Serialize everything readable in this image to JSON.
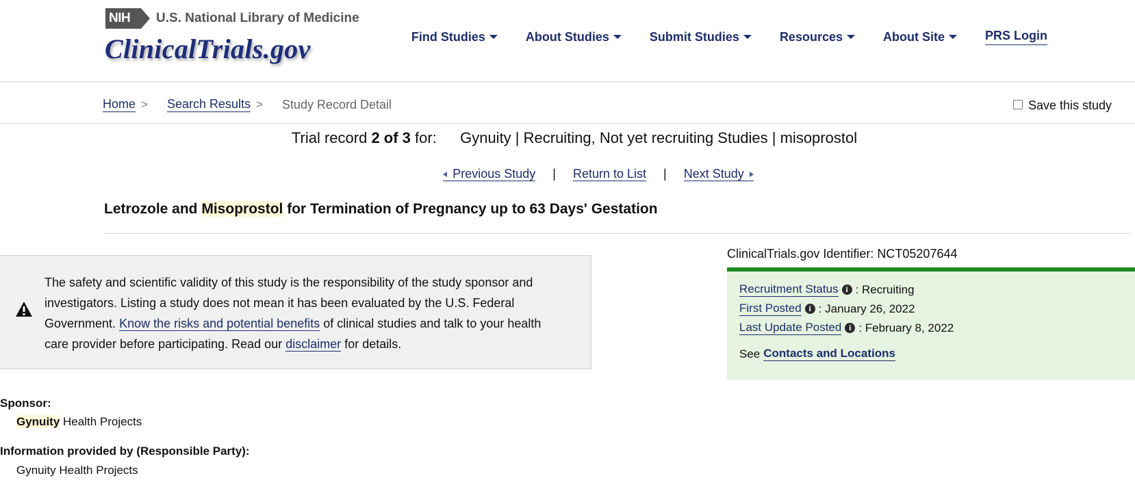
{
  "header": {
    "nih_badge": "NIH",
    "library_name": "U.S. National Library of Medicine",
    "site_logo": "ClinicalTrials.gov",
    "nav": [
      {
        "label": "Find Studies"
      },
      {
        "label": "About Studies"
      },
      {
        "label": "Submit Studies"
      },
      {
        "label": "Resources"
      },
      {
        "label": "About Site"
      }
    ],
    "prs_login": "PRS Login"
  },
  "breadcrumb": {
    "home": "Home",
    "search_results": "Search Results",
    "current": "Study Record Detail",
    "separator": ">"
  },
  "save_study_label": "Save this study",
  "trial_record": {
    "prefix": "Trial record",
    "position": "2 of 3",
    "suffix": "for:",
    "query": "Gynuity | Recruiting, Not yet recruiting Studies | misoprostol"
  },
  "pager": {
    "previous": "Previous Study",
    "return": "Return to List",
    "next": "Next Study",
    "separator": "|"
  },
  "study_title": {
    "part1": "Letrozole and",
    "highlight": "Misoprostol",
    "part2": "for Termination of Pregnancy up to 63 Days' Gestation"
  },
  "disclaimer": {
    "text1": "The safety and scientific validity of this study is the responsibility of the study sponsor and investigators. Listing a study does not mean it has been evaluated by the U.S. Federal Government.",
    "link1": "Know the risks and potential benefits",
    "text2": "of clinical studies and talk to your health care provider before participating. Read our",
    "link2": "disclaimer",
    "text3": "for details."
  },
  "identifier": "ClinicalTrials.gov Identifier: NCT05207644",
  "status": {
    "recruitment_label": "Recruitment Status",
    "recruitment_value": ": Recruiting",
    "first_posted_label": "First Posted",
    "first_posted_value": ": January 26, 2022",
    "last_update_label": "Last Update Posted",
    "last_update_value": ": February 8, 2022",
    "see": "See",
    "contacts_link": "Contacts and Locations"
  },
  "sponsor": {
    "label": "Sponsor:",
    "highlight": "Gynuity",
    "rest": "Health Projects"
  },
  "responsible_party": {
    "label": "Information provided by (Responsible Party):",
    "value": "Gynuity Health Projects"
  },
  "colors": {
    "nav_blue": "#1d2e6a",
    "logo_blue": "#1e2d7a",
    "status_green": "#1e8a1e",
    "status_bg": "#e5f3e0",
    "highlight": "#fdf9d8"
  }
}
